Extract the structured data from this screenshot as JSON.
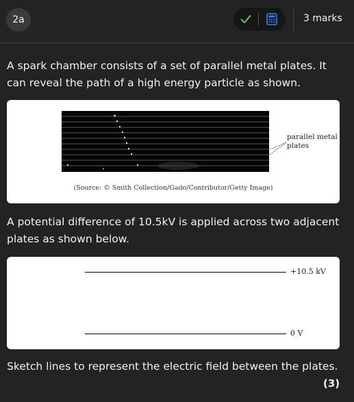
{
  "header": {
    "question_number": "2a",
    "marks": "3 marks"
  },
  "question": {
    "intro": "A spark chamber consists of a set of parallel metal plates. It can reveal the path of a high energy particle as shown.",
    "figure1": {
      "annotation_line1": "parallel metal",
      "annotation_line2": "plates",
      "source": "(Source: © Smith Collection/Gado/Contributor/Getty Image)"
    },
    "potential_text": "A potential difference of 10.5kV is applied across two adjacent plates as shown below.",
    "figure2": {
      "top_plate_label": "+10.5 kV",
      "bottom_plate_label": "0 V"
    },
    "task": "Sketch lines to represent the electric field between the plates.",
    "score": "(3)"
  },
  "icons": {
    "check": "check-icon",
    "calculator": "calculator-icon"
  },
  "colors": {
    "background": "#232323",
    "check_green": "#5bd47a",
    "calculator_blue": "#3d7bf2",
    "card": "#ffffff"
  }
}
